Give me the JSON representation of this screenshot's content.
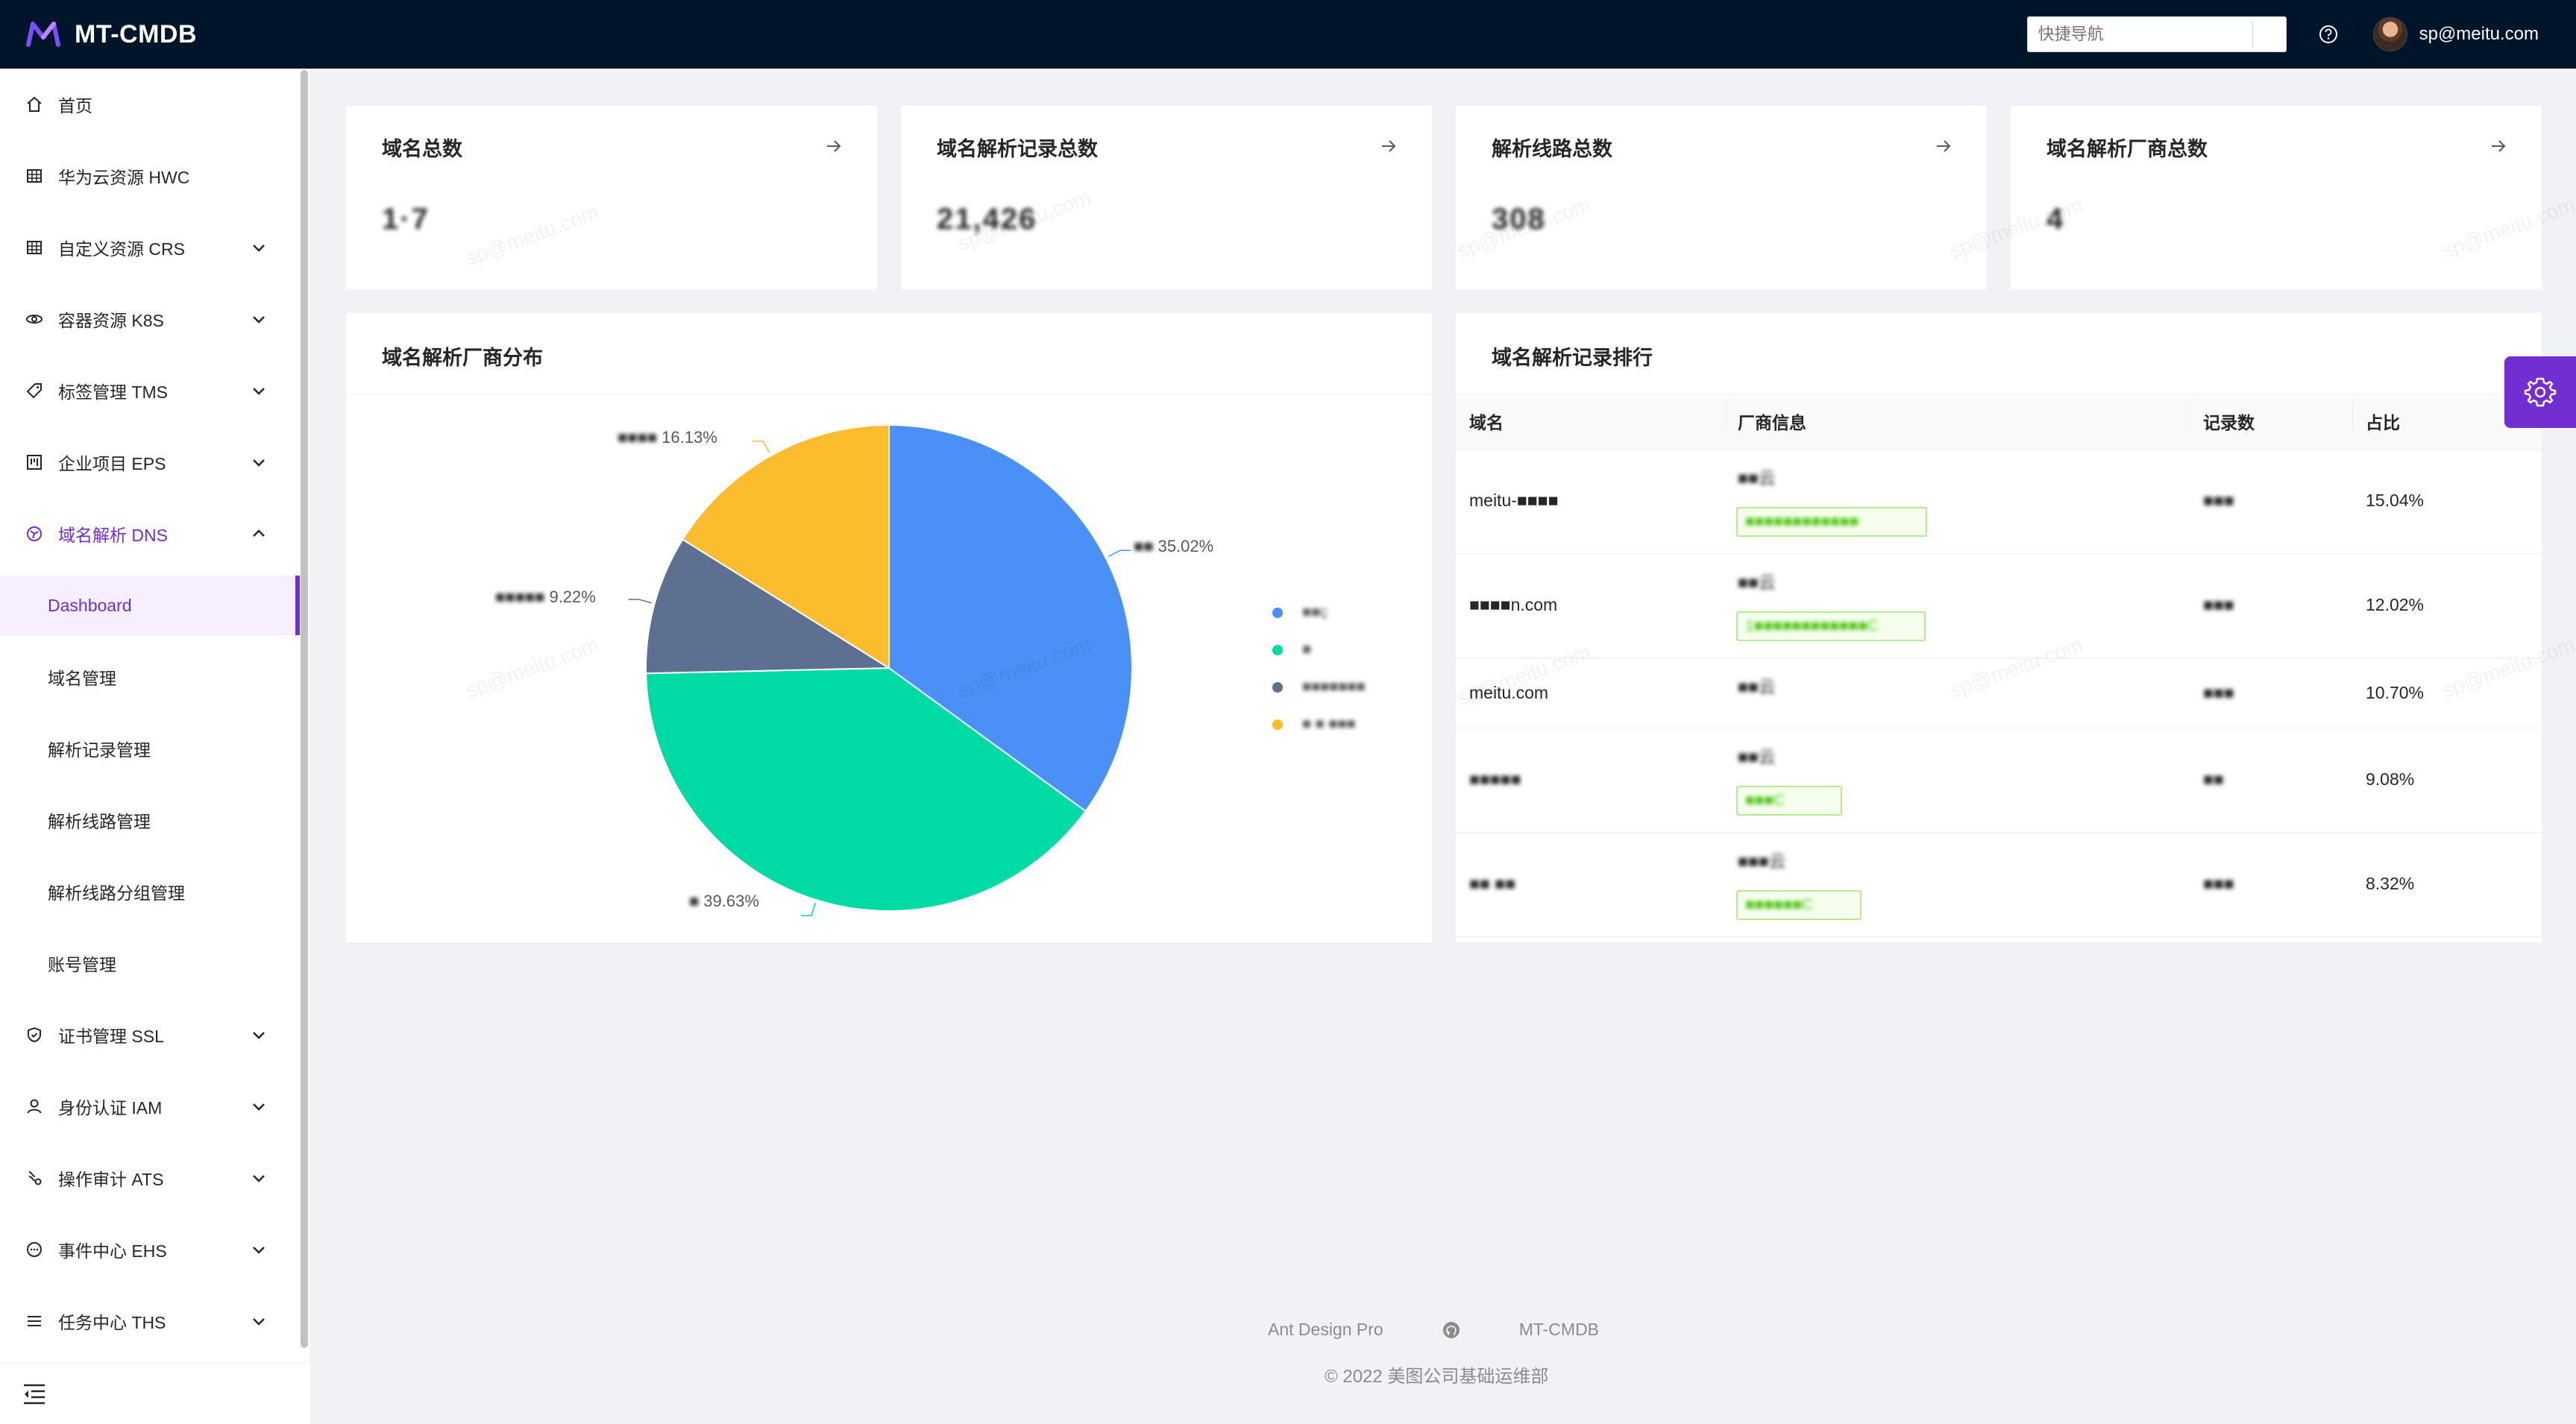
{
  "app": {
    "title": "MT-CMDB"
  },
  "header": {
    "quick_nav_placeholder": "快捷导航",
    "user_name": "sp@meitu.com"
  },
  "sidebar": {
    "items": [
      {
        "label": "首页",
        "icon": "home-icon"
      },
      {
        "label": "华为云资源 HWC",
        "icon": "table-icon"
      },
      {
        "label": "自定义资源 CRS",
        "icon": "table-icon"
      },
      {
        "label": "容器资源 K8S",
        "icon": "cloud-icon"
      },
      {
        "label": "标签管理 TMS",
        "icon": "tag-icon"
      },
      {
        "label": "企业项目 EPS",
        "icon": "project-icon"
      },
      {
        "label": "域名解析 DNS",
        "icon": "dns-icon"
      },
      {
        "label": "证书管理 SSL",
        "icon": "shield-icon"
      },
      {
        "label": "身份认证 IAM",
        "icon": "user-icon"
      },
      {
        "label": "操作审计 ATS",
        "icon": "audit-icon"
      },
      {
        "label": "事件中心 EHS",
        "icon": "message-icon"
      },
      {
        "label": "任务中心 THS",
        "icon": "list-icon"
      }
    ],
    "dns_sub_items": [
      "Dashboard",
      "域名管理",
      "解析记录管理",
      "解析线路管理",
      "解析线路分组管理",
      "账号管理"
    ]
  },
  "stats": [
    {
      "title": "域名总数",
      "value": "1·7"
    },
    {
      "title": "域名解析记录总数",
      "value": "21,426"
    },
    {
      "title": "解析线路总数",
      "value": "308"
    },
    {
      "title": "域名解析厂商总数",
      "value": "4"
    }
  ],
  "pie": {
    "title": "域名解析厂商分布",
    "labels": [
      {
        "name": "■■",
        "pct": "35.02%"
      },
      {
        "name": "■",
        "pct": "39.63%"
      },
      {
        "name": "■■■■■",
        "pct": "9.22%"
      },
      {
        "name": "■■■■",
        "pct": "16.13%"
      }
    ],
    "legend": [
      "■■ç",
      "■",
      "■■■■■■■",
      "■ ■ ■■■"
    ]
  },
  "chart_data": {
    "type": "pie",
    "title": "域名解析厂商分布",
    "series": [
      {
        "name": "",
        "value": 35.02,
        "color": "#4a90f7"
      },
      {
        "name": "",
        "value": 39.63,
        "color": "#00dba5"
      },
      {
        "name": "",
        "value": 9.22,
        "color": "#5d7092"
      },
      {
        "name": "",
        "value": 16.13,
        "color": "#fbbd2d"
      }
    ],
    "legend_position": "right"
  },
  "ranking": {
    "title": "域名解析记录排行",
    "columns": [
      "域名",
      "厂商信息",
      "记录数",
      "占比"
    ],
    "rows": [
      {
        "domain": "meitu-■■■■",
        "vendor": "■■云",
        "tag": "■■■■■■■■■■■■",
        "count": "■■■",
        "pct": "15.04%"
      },
      {
        "domain": "■■■■n.com",
        "vendor": "■■云",
        "tag": "1■■■■■■■■■■■■C",
        "count": "■■■",
        "pct": "12.02%"
      },
      {
        "domain": "meitu.com",
        "vendor": "■■云",
        "tag": "",
        "count": "■■■",
        "pct": "10.70%"
      },
      {
        "domain": "■■■■■",
        "vendor": "■■云",
        "tag": "■■■C",
        "count": "■■",
        "pct": "9.08%"
      },
      {
        "domain": "■■ ■■",
        "vendor": "■■■云",
        "tag": "■■■■■■C",
        "count": "■■■",
        "pct": "8.32%"
      }
    ]
  },
  "watermark": "sp@meitu.com",
  "footer": {
    "link1": "Ant Design Pro",
    "link2": "MT-CMDB",
    "copyright": "© 2022 美图公司基础运维部"
  },
  "colors": {
    "primary": "#722ed1",
    "header_bg": "#001529",
    "tag_green": "#52c41a"
  }
}
